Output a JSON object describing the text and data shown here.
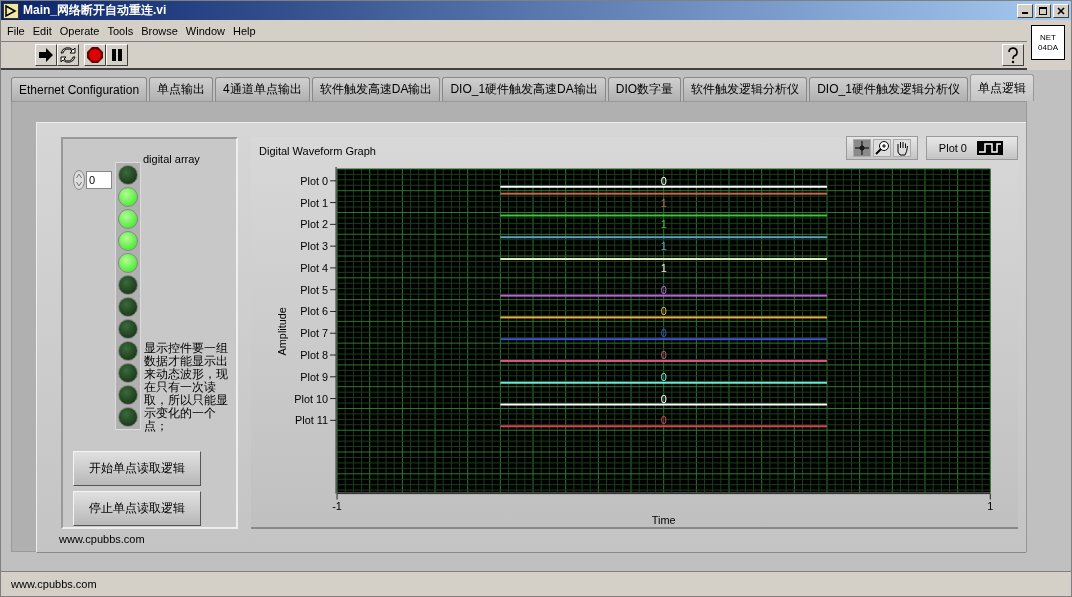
{
  "window": {
    "title": "Main_网络断开自动重连.vi"
  },
  "menu": [
    "File",
    "Edit",
    "Operate",
    "Tools",
    "Browse",
    "Window",
    "Help"
  ],
  "vi_icon": {
    "lines": [
      "NET",
      "04DA"
    ]
  },
  "tabs": [
    {
      "label": "Ethernet Configuration",
      "selected": false
    },
    {
      "label": "单点输出",
      "selected": false
    },
    {
      "label": "4通道单点输出",
      "selected": false
    },
    {
      "label": "软件触发高速DA输出",
      "selected": false
    },
    {
      "label": "DIO_1硬件触发高速DA输出",
      "selected": false
    },
    {
      "label": "DIO数字量",
      "selected": false
    },
    {
      "label": "软件触发逻辑分析仪",
      "selected": false
    },
    {
      "label": "DIO_1硬件触发逻辑分析仪",
      "selected": false
    },
    {
      "label": "单点逻辑",
      "selected": true
    }
  ],
  "digital_array": {
    "label": "digital array",
    "index": "0",
    "leds": [
      {
        "on": false
      },
      {
        "on": true
      },
      {
        "on": true
      },
      {
        "on": true
      },
      {
        "on": true
      },
      {
        "on": false
      },
      {
        "on": false
      },
      {
        "on": false
      },
      {
        "on": false
      },
      {
        "on": false
      },
      {
        "on": false
      },
      {
        "on": false
      }
    ]
  },
  "note": "显示控件要一组数据才能显示出来动态波形，现在只有一次读取，所以只能显示变化的一个点；",
  "buttons": [
    "开始单点读取逻辑",
    "停止单点读取逻辑"
  ],
  "graph": {
    "label": "Digital Waveform Graph",
    "legend": "Plot 0",
    "x_title": "Time",
    "y_title": "Amplitude",
    "x_min": "-1",
    "x_max": "1",
    "plots": [
      {
        "name": "Plot 0",
        "color": "#ffffff",
        "value": "0",
        "high": false
      },
      {
        "name": "Plot 1",
        "color": "#c86450",
        "value": "1",
        "high": true
      },
      {
        "name": "Plot 2",
        "color": "#40c040",
        "value": "1",
        "high": true
      },
      {
        "name": "Plot 3",
        "color": "#60a0c8",
        "value": "1",
        "high": true
      },
      {
        "name": "Plot 4",
        "color": "#e8f0c0",
        "value": "1",
        "high": true
      },
      {
        "name": "Plot 5",
        "color": "#c060e0",
        "value": "0",
        "high": false
      },
      {
        "name": "Plot 6",
        "color": "#f0b040",
        "value": "0",
        "high": false
      },
      {
        "name": "Plot 7",
        "color": "#4050d0",
        "value": "0",
        "high": false
      },
      {
        "name": "Plot 8",
        "color": "#e0508a",
        "value": "0",
        "high": false
      },
      {
        "name": "Plot 9",
        "color": "#70e8e0",
        "value": "0",
        "high": false
      },
      {
        "name": "Plot 10",
        "color": "#ffffff",
        "value": "0",
        "high": false
      },
      {
        "name": "Plot 11",
        "color": "#e04050",
        "value": "0",
        "high": false
      }
    ]
  },
  "panel_footer": "www.cpubbs.com",
  "status_bar": "www.cpubbs.com"
}
